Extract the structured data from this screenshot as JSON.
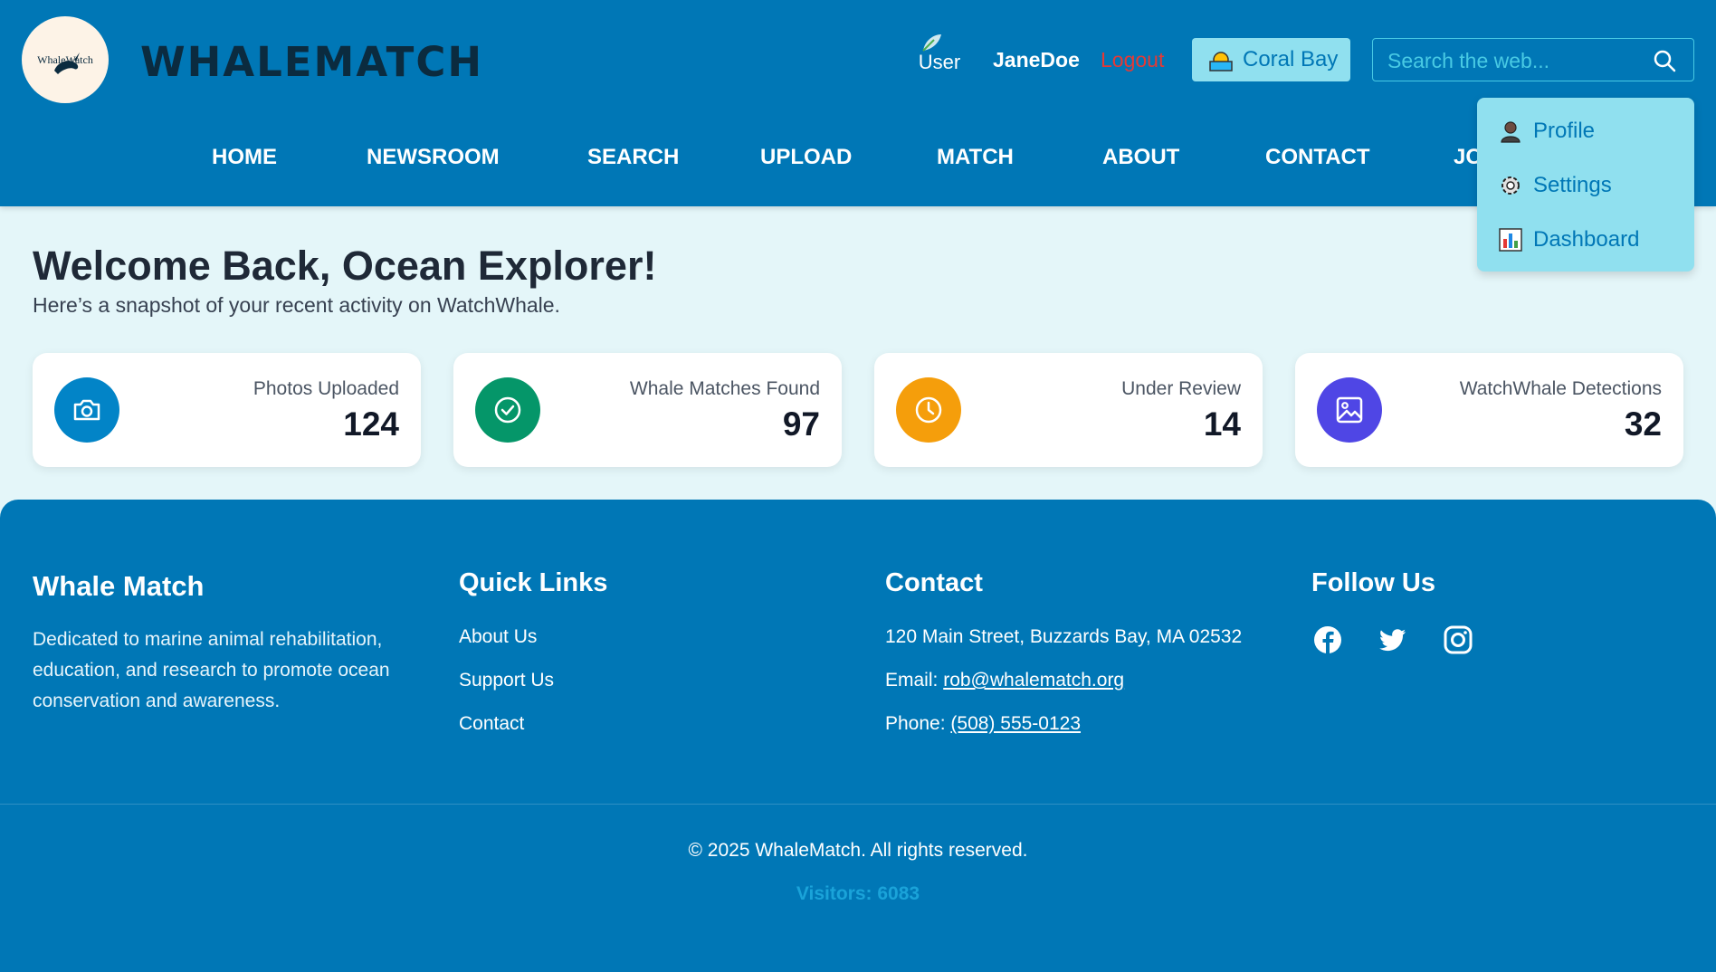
{
  "header": {
    "logo_text": "WhaleWatch",
    "brand": "WHALEMATCH",
    "user_avatar_alt": "User",
    "username": "JaneDoe",
    "logout_label": "Logout",
    "location_label": "Coral Bay",
    "search_placeholder": "Search the web..."
  },
  "nav": {
    "items": [
      {
        "label": "HOME"
      },
      {
        "label": "NEWSROOM"
      },
      {
        "label": "SEARCH"
      },
      {
        "label": "UPLOAD"
      },
      {
        "label": "MATCH"
      },
      {
        "label": "ABOUT"
      },
      {
        "label": "CONTACT"
      },
      {
        "label": "JO"
      }
    ]
  },
  "dropdown": {
    "items": [
      {
        "label": "Profile",
        "icon": "person-icon"
      },
      {
        "label": "Settings",
        "icon": "gear-icon"
      },
      {
        "label": "Dashboard",
        "icon": "bar-chart-icon"
      }
    ]
  },
  "main": {
    "title": "Welcome Back, Ocean Explorer!",
    "subtitle": "Here’s a snapshot of your recent activity on WatchWhale.",
    "stats": [
      {
        "label": "Photos Uploaded",
        "value": "124",
        "icon": "camera-icon",
        "color": "#0284c7"
      },
      {
        "label": "Whale Matches Found",
        "value": "97",
        "icon": "check-circle-icon",
        "color": "#059669"
      },
      {
        "label": "Under Review",
        "value": "14",
        "icon": "clock-icon",
        "color": "#f59e0b"
      },
      {
        "label": "WatchWhale Detections",
        "value": "32",
        "icon": "image-icon",
        "color": "#4f46e5"
      }
    ]
  },
  "footer": {
    "about": {
      "title": "Whale Match",
      "text": "Dedicated to marine animal rehabilitation, education, and research to promote ocean conservation and awareness."
    },
    "quick_links": {
      "title": "Quick Links",
      "items": [
        "About Us",
        "Support Us",
        "Contact"
      ]
    },
    "contact": {
      "title": "Contact",
      "address": "120 Main Street, Buzzards Bay, MA 02532",
      "email_label": "Email:",
      "email": "rob@whalematch.org",
      "phone_label": "Phone:",
      "phone": "(508) 555-0123"
    },
    "follow": {
      "title": "Follow Us",
      "icons": [
        "facebook-icon",
        "twitter-icon",
        "instagram-icon"
      ]
    },
    "copyright": "© 2025 WhaleMatch. All rights reserved.",
    "visitors": "Visitors: 6083"
  },
  "colors": {
    "primary": "#0077b6",
    "accent_light": "#90e0ef",
    "background": "#e4f6f9",
    "logout": "#e53935"
  }
}
